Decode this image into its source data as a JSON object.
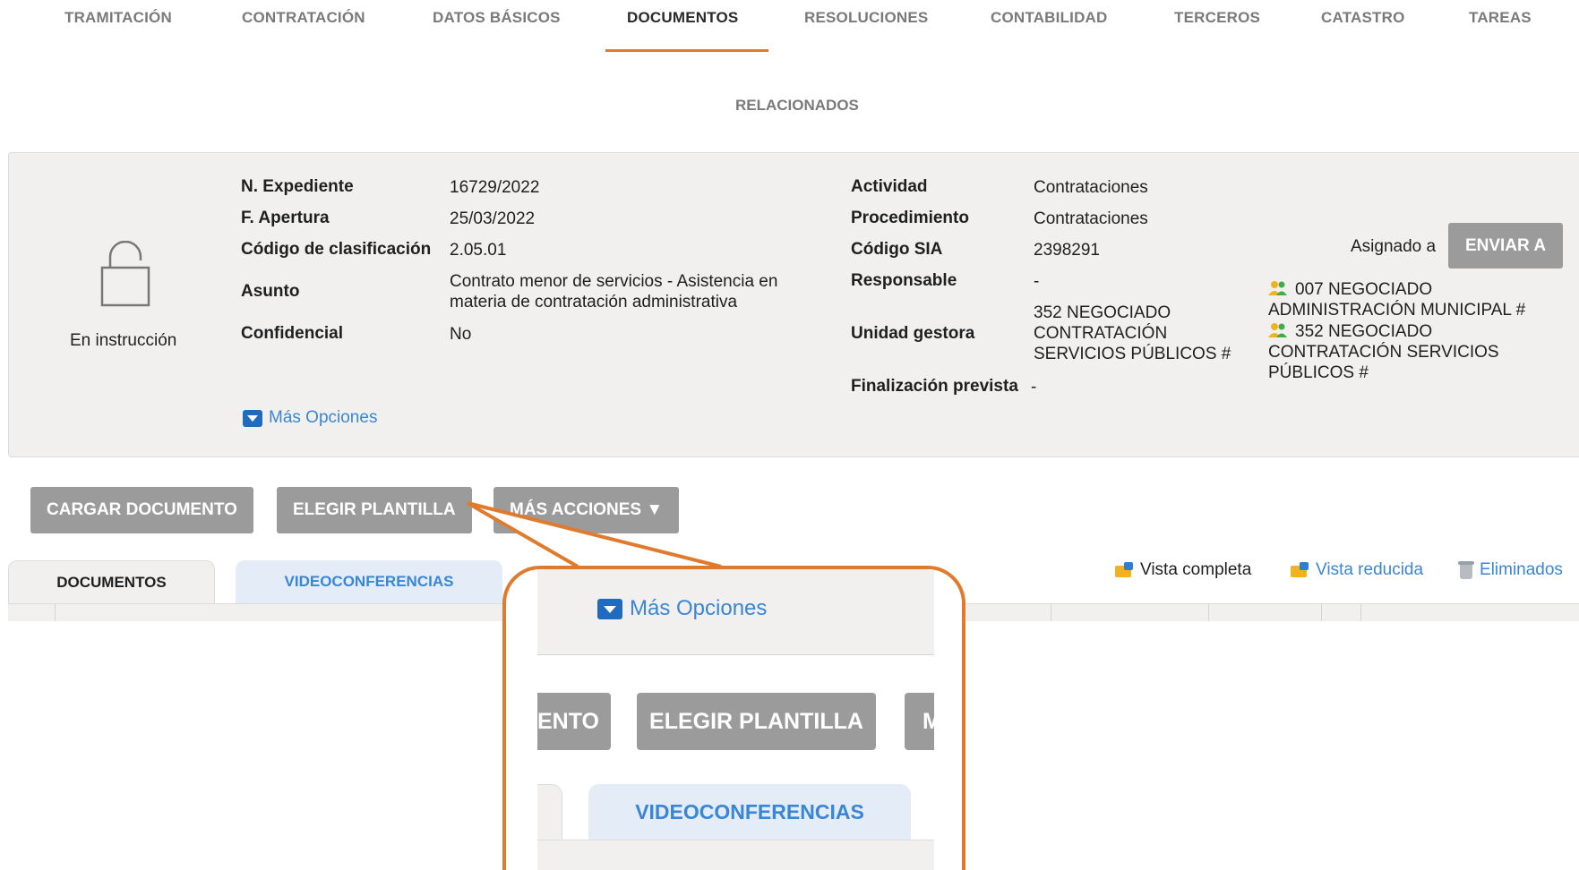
{
  "nav": {
    "items": [
      "TRAMITACIÓN",
      "CONTRATACIÓN",
      "DATOS BÁSICOS",
      "DOCUMENTOS",
      "RESOLUCIONES",
      "CONTABILIDAD",
      "TERCEROS",
      "CATASTRO",
      "TAREAS"
    ],
    "active": "DOCUMENTOS",
    "related": "RELACIONADOS"
  },
  "expediente": {
    "status": "En instrucción",
    "left": {
      "numero_label": "N. Expediente",
      "numero": "16729/2022",
      "apertura_label": "F. Apertura",
      "apertura": "25/03/2022",
      "codigo_label": "Código de clasificación",
      "codigo": "2.05.01",
      "asunto_label": "Asunto",
      "asunto": "Contrato menor de servicios - Asistencia en materia de contratación administrativa",
      "confidencial_label": "Confidencial",
      "confidencial": "No"
    },
    "right": {
      "actividad_label": "Actividad",
      "actividad": "Contrataciones",
      "procedimiento_label": "Procedimiento",
      "procedimiento": "Contrataciones",
      "sia_label": "Código SIA",
      "sia": "2398291",
      "responsable_label": "Responsable",
      "responsable": "-",
      "unidad_label": "Unidad gestora",
      "unidad": "352 NEGOCIADO CONTRATACIÓN SERVICIOS PÚBLICOS #",
      "finalizacion_label": "Finalización prevista",
      "finalizacion": "-"
    },
    "more_options": "Más Opciones",
    "assigned_label": "Asignado a",
    "send_button": "ENVIAR A",
    "assignees": [
      "007 NEGOCIADO ADMINISTRACIÓN MUNICIPAL #",
      "352 NEGOCIADO CONTRATACIÓN SERVICIOS PÚBLICOS #"
    ]
  },
  "actions": {
    "upload": "CARGAR DOCUMENTO",
    "template": "ELEGIR PLANTILLA",
    "more": "MÁS ACCIONES ▼"
  },
  "tabs": {
    "documents": "DOCUMENTOS",
    "video": "VIDEOCONFERENCIAS"
  },
  "views": {
    "full": "Vista completa",
    "reduced": "Vista reducida",
    "deleted": "Eliminados"
  },
  "zoom": {
    "more_options": "Más Opciones",
    "upload_fragment": "ENTO",
    "template": "ELEGIR PLANTILLA",
    "more_fragment": "M",
    "video": "VIDEOCONFERENCIAS"
  },
  "colors": {
    "accent": "#e07b2d",
    "link": "#3a86d6",
    "button": "#9b9b9b",
    "panel": "#f1f0ef"
  }
}
